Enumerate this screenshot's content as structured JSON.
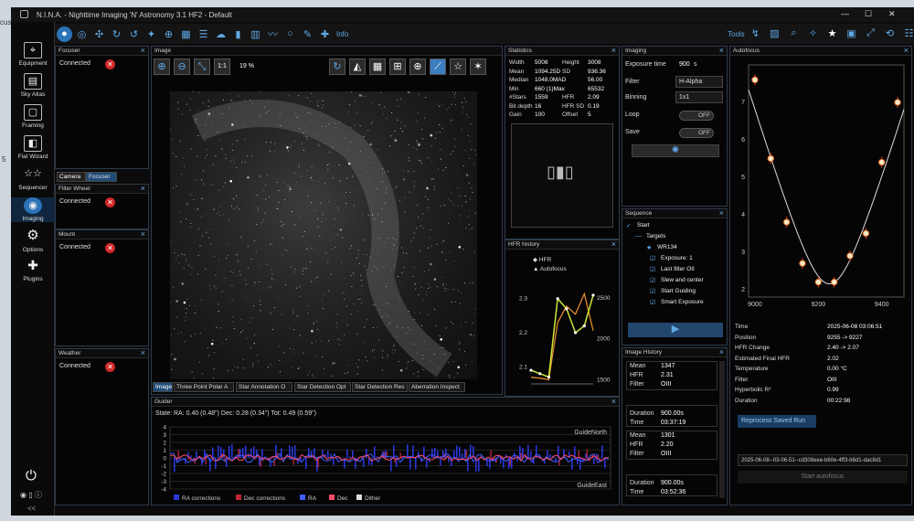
{
  "desktop": {
    "fragment_left": "cus",
    "fragment_label": "5"
  },
  "window": {
    "title": "N.I.N.A. - Nighttime Imaging 'N' Astronomy 3.1 HF2 - Default",
    "min": "—",
    "max": "☐",
    "close": "✕"
  },
  "toolbar": {
    "info_label": "Info",
    "tools_label": "Tools"
  },
  "sidebar": {
    "items": [
      {
        "label": "Equipment",
        "icon": "telescope-icon"
      },
      {
        "label": "Sky Atlas",
        "icon": "atlas-icon"
      },
      {
        "label": "Framing",
        "icon": "framing-icon"
      },
      {
        "label": "Flat Wizard",
        "icon": "flat-wizard-icon"
      },
      {
        "label": "Sequencer",
        "icon": "sequencer-icon"
      },
      {
        "label": "Imaging",
        "icon": "imaging-icon"
      },
      {
        "label": "Options",
        "icon": "gear-icon"
      },
      {
        "label": "Plugins",
        "icon": "puzzle-icon"
      }
    ],
    "collapse": "<<"
  },
  "panels": {
    "focuser": {
      "title": "Focuser",
      "status": "Connected"
    },
    "camera_tabs": [
      "Camera",
      "Focuser"
    ],
    "filter_wheel": {
      "title": "Filter Wheel",
      "status": "Connected"
    },
    "mount": {
      "title": "Mount",
      "status": "Connected"
    },
    "weather": {
      "title": "Weather",
      "status": "Connected"
    },
    "image": {
      "title": "Image",
      "zoom": "19 %",
      "one_to_one": "1:1",
      "tabs": [
        "Image",
        "Three Point Polar A",
        "Star Annotation O",
        "Star Detection Opt",
        "Star Detection Res",
        "Aberration Inspect"
      ]
    },
    "statistics": {
      "title": "Statistics",
      "rows": [
        [
          "Width",
          "5008",
          "Height",
          "3008"
        ],
        [
          "Mean",
          "1094.25D",
          "SD",
          "936.36"
        ],
        [
          "Median",
          "1048.0MAD",
          "",
          "56.00"
        ],
        [
          "Min",
          "660 (1)Max",
          "",
          "65532"
        ],
        [
          "#Stars",
          "1559",
          "HFR",
          "2.09"
        ],
        [
          "Bit depth",
          "16",
          "HFR SD",
          "0.19"
        ],
        [
          "Gain",
          "100",
          "Offset",
          "5"
        ]
      ]
    },
    "hfr_history": {
      "title": "HFR history",
      "legend": [
        "HFR",
        "Autofocus"
      ]
    },
    "imaging": {
      "title": "Imaging",
      "exposure_label": "Exposure time",
      "exposure_value": "900",
      "exposure_unit": "s",
      "filter_label": "Filter",
      "filter_value": "H-Alpha",
      "binning_label": "Binning",
      "binning_value": "1x1",
      "loop_label": "Loop",
      "loop_value": "OFF",
      "save_label": "Save",
      "save_value": "OFF"
    },
    "sequence": {
      "title": "Sequence",
      "items": [
        "Start",
        "Targets",
        "WR134",
        "Exposure: 1",
        "Last filter OII",
        "Slew and center",
        "Start Guiding",
        "Smart Exposure"
      ]
    },
    "image_history": {
      "title": "Image History",
      "entries": [
        {
          "mean": "1347",
          "hfr": "2.31",
          "filter": "OIII",
          "duration": "900.00s",
          "time": "03:37:19"
        },
        {
          "mean": "1301",
          "hfr": "2.20",
          "filter": "OIII",
          "duration": "900.00s",
          "time": "03:52:36"
        }
      ],
      "labels": {
        "mean": "Mean",
        "hfr": "HFR",
        "filter": "Filter",
        "duration": "Duration",
        "time": "Time"
      }
    },
    "guider": {
      "title": "Guider",
      "state": "State:",
      "rms": "RA: 0.40 (0.48\")  Dec: 0.28 (0.34\")  Tot: 0.49 (0.59\")",
      "north": "GuideNorth",
      "east": "GuideEast",
      "yticks": [
        "4",
        "3",
        "2",
        "1",
        "0",
        "-1",
        "-2",
        "-3",
        "-4"
      ],
      "legend": [
        "RA corrections",
        "Dec corrections",
        "RA",
        "Dec",
        "Dither"
      ]
    },
    "autofocus": {
      "title": "Autofocus",
      "fields": [
        [
          "Time",
          "2025-06-08 03:06:51"
        ],
        [
          "Position",
          "9255 -> 9227"
        ],
        [
          "HFR Change",
          "2.40 -> 2.07"
        ],
        [
          "Estimated Final HFR",
          "2.02"
        ],
        [
          "Temperature",
          "0.00 °C"
        ],
        [
          "Filter",
          "OIII"
        ],
        [
          "Hyperbolic R²",
          "0.99"
        ],
        [
          "Duration",
          "00:22:98"
        ]
      ],
      "reprocess": "Reprocess Saved Run",
      "run_select": "2025-06-08--03-06-51--cd308eee-b60e-4ff3-b6d1-dac8d1",
      "start": "Start autofocus"
    }
  },
  "chart_data": [
    {
      "type": "scatter",
      "title": "Autofocus",
      "x": [
        9000,
        9050,
        9100,
        9150,
        9200,
        9250,
        9300,
        9350,
        9400,
        9450
      ],
      "y": [
        7.6,
        5.5,
        3.8,
        2.7,
        2.2,
        2.2,
        2.9,
        3.5,
        5.4,
        7.0
      ],
      "xticks": [
        "9000",
        "9200",
        "9400"
      ],
      "yticks": [
        "2",
        "3",
        "4",
        "5",
        "6",
        "7"
      ],
      "xlim": [
        8980,
        9470
      ],
      "ylim": [
        1.8,
        8
      ],
      "fit": "hyperbolic"
    },
    {
      "type": "line",
      "title": "HFR history",
      "series": [
        {
          "name": "HFR",
          "values": [
            2.09,
            2.08,
            2.07,
            2.3,
            2.27,
            2.2,
            2.22,
            2.31
          ]
        },
        {
          "name": "Autofocus",
          "values": [
            1530,
            1520,
            1500,
            2200,
            2400,
            2300,
            2550,
            2100
          ]
        }
      ],
      "yleft": [
        "2.1",
        "2.2",
        "2.3"
      ],
      "yright": [
        "1500",
        "2000",
        "2500"
      ],
      "ylim_left": [
        2.05,
        2.35
      ],
      "ylim_right": [
        1450,
        2700
      ]
    }
  ]
}
